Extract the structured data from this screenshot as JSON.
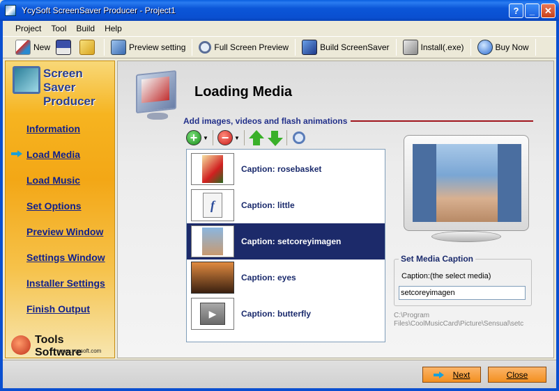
{
  "window": {
    "title": "YcySoft ScreenSaver Producer - Project1",
    "help_label": "?",
    "min_label": "_",
    "close_label": "✕"
  },
  "menu": {
    "items": [
      "Project",
      "Tool",
      "Build",
      "Help"
    ]
  },
  "toolbar": {
    "new_label": "New",
    "preview_setting_label": "Preview setting",
    "full_screen_label": "Full Screen Preview",
    "build_label": "Build ScreenSaver",
    "install_label": "Install(.exe)",
    "buy_label": "Buy Now"
  },
  "sidebar": {
    "logo_line1": "Screen Saver",
    "logo_line2": "Producer",
    "items": [
      {
        "label": "Information",
        "active": false
      },
      {
        "label": "Load Media",
        "active": true
      },
      {
        "label": "Load Music",
        "active": false
      },
      {
        "label": "Set Options",
        "active": false
      },
      {
        "label": "Preview Window",
        "active": false
      },
      {
        "label": "Settings Window",
        "active": false
      },
      {
        "label": "Installer Settings",
        "active": false
      },
      {
        "label": "Finish Output",
        "active": false
      }
    ],
    "brand": "Tools Software",
    "brand_url": "www.ycysoft.com"
  },
  "content": {
    "title": "Loading Media",
    "subtitle": "Add images, videos and flash animations",
    "media": [
      {
        "caption": "Caption: rosebasket",
        "thumb": "image",
        "selected": false
      },
      {
        "caption": "Caption: little",
        "thumb": "flash-icon",
        "selected": false
      },
      {
        "caption": "Caption: setcoreyimagen",
        "thumb": "image",
        "selected": true
      },
      {
        "caption": "Caption: eyes",
        "thumb": "image",
        "selected": false
      },
      {
        "caption": "Caption: butterfly",
        "thumb": "video-icon",
        "selected": false
      }
    ],
    "caption_group": {
      "legend": "Set Media Caption",
      "label": "Caption:(the select media)",
      "value": "setcoreyimagen"
    },
    "path": "C:\\Program\nFiles\\CoolMusicCard\\Picture\\Sensual\\setc"
  },
  "footer": {
    "next_label": "Next",
    "close_label": "Close"
  },
  "colors": {
    "accent": "#1c2a6a",
    "sidebar": "#f3a716",
    "button": "#f39020",
    "titlebar": "#0a4fd0"
  }
}
